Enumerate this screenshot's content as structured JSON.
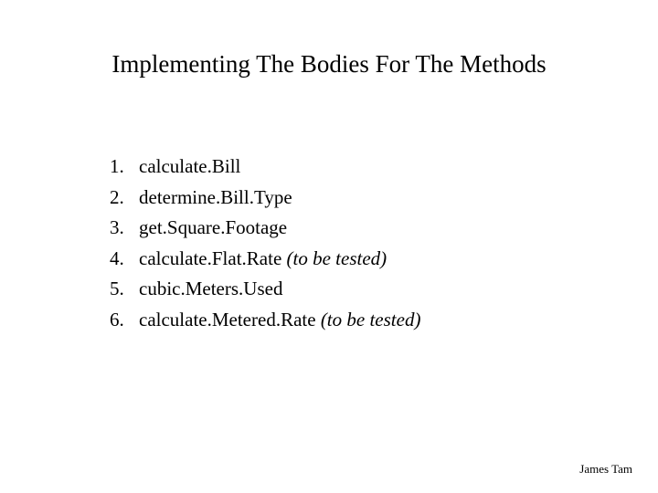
{
  "title": "Implementing The Bodies For The Methods",
  "items": [
    {
      "num": "1.",
      "text": "calculate.Bill",
      "note": ""
    },
    {
      "num": "2.",
      "text": "determine.Bill.Type",
      "note": ""
    },
    {
      "num": "3.",
      "text": "get.Square.Footage",
      "note": ""
    },
    {
      "num": "4.",
      "text": "calculate.Flat.Rate ",
      "note": "(to be tested)"
    },
    {
      "num": "5.",
      "text": "cubic.Meters.Used",
      "note": ""
    },
    {
      "num": "6.",
      "text": "calculate.Metered.Rate ",
      "note": "(to be tested)"
    }
  ],
  "footer": "James Tam"
}
